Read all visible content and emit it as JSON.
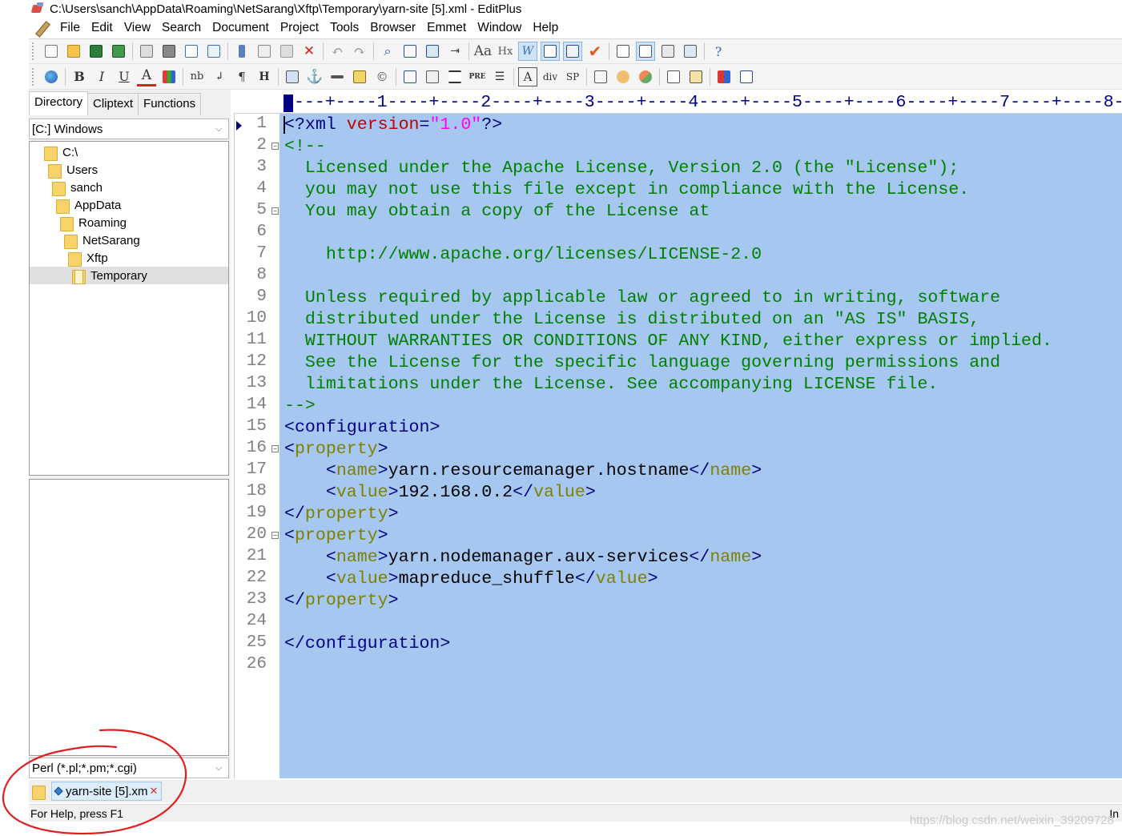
{
  "window": {
    "title": "C:\\Users\\sanch\\AppData\\Roaming\\NetSarang\\Xftp\\Temporary\\yarn-site [5].xml - EditPlus"
  },
  "menu": [
    "File",
    "Edit",
    "View",
    "Search",
    "Document",
    "Project",
    "Tools",
    "Browser",
    "Emmet",
    "Window",
    "Help"
  ],
  "toolbar2_labels": {
    "bold": "B",
    "italic": "I",
    "underline": "U",
    "font_color": "A",
    "nbsp": "nb",
    "br": "↲",
    "para": "¶",
    "heading": "H",
    "pre": "PRE",
    "div": "div",
    "span": "SP",
    "hx": "Hx"
  },
  "left_panel": {
    "tabs": [
      "Directory",
      "Cliptext",
      "Functions"
    ],
    "drive": "[C:] Windows",
    "tree": [
      "C:\\",
      "Users",
      "sanch",
      "AppData",
      "Roaming",
      "NetSarang",
      "Xftp",
      "Temporary"
    ],
    "selected_folder": "Temporary",
    "file_type": "Perl (*.pl;*.pm;*.cgi)"
  },
  "ruler": "----+----1----+----2----+----3----+----4----+----5----+----6----+----7----+----8-",
  "editor": {
    "line_numbers": [
      "1",
      "2",
      "3",
      "4",
      "5",
      "6",
      "7",
      "8",
      "9",
      "10",
      "11",
      "12",
      "13",
      "14",
      "15",
      "16",
      "17",
      "18",
      "19",
      "20",
      "21",
      "22",
      "23",
      "24",
      "25",
      "26"
    ],
    "lines": {
      "l1": {
        "open": "<?",
        "name": "xml",
        "attr": " version",
        "eq": "=",
        "val": "\"1.0\"",
        "close": "?>"
      },
      "l2": "<!--",
      "l3": "  Licensed under the Apache License, Version 2.0 (the \"License\");",
      "l4": "  you may not use this file except in compliance with the License.",
      "l5": "  You may obtain a copy of the License at",
      "l7": "    http://www.apache.org/licenses/LICENSE-2.0",
      "l9": "  Unless required by applicable law or agreed to in writing, software",
      "l10": "  distributed under the License is distributed on an \"AS IS\" BASIS,",
      "l11": "  WITHOUT WARRANTIES OR CONDITIONS OF ANY KIND, either express or implied.",
      "l12": "  See the License for the specific language governing permissions and",
      "l13": "  limitations under the License. See accompanying LICENSE file.",
      "l14": "-->",
      "configuration_tag": "configuration",
      "property_tag": "property",
      "name_tag": "name",
      "value_tag": "value",
      "l17_text": "yarn.resourcemanager.hostname",
      "l18_text": "192.168.0.2",
      "l21_text": "yarn.nodemanager.aux-services",
      "l22_text": "mapreduce_shuffle"
    }
  },
  "doc_tab": {
    "label": "yarn-site [5].xm"
  },
  "status": {
    "left": "For Help, press F1",
    "right": "In"
  },
  "watermark": "https://blog.csdn.net/weixin_39209728",
  "colors": {
    "selection": "#a6c8f0",
    "comment": "#008000",
    "tag": "#000080",
    "tagname": "#808000",
    "attr": "#c00000",
    "string": "#ff00ff",
    "annotation": "#e02020"
  }
}
